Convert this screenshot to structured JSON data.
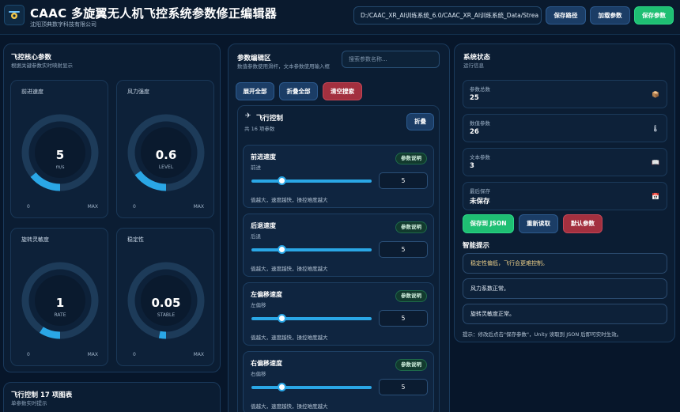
{
  "header": {
    "title": "CAAC 多旋翼无人机飞控系统参数修正编辑器",
    "company": "沈阳顶典数字科技有限公司",
    "path": "D:/CAAC_XR_AI训练系统_6.0/CAAC_XR_AI训练系统_Data/Strea",
    "save_path": "保存路径",
    "load_params": "加载参数",
    "save_params": "保存参数"
  },
  "core": {
    "title": "飞控核心参数",
    "subtitle": "根据关键参数实时映射显示",
    "gauges": [
      {
        "label": "前进速度",
        "value": "5",
        "unit": "m/s",
        "min": "0",
        "max": "MAX",
        "fraction": 0.14
      },
      {
        "label": "风力强度",
        "value": "0.6",
        "unit": "LEVEL",
        "min": "0",
        "max": "MAX",
        "fraction": 0.15
      },
      {
        "label": "旋转灵敏度",
        "value": "1",
        "unit": "RATE",
        "min": "0",
        "max": "MAX",
        "fraction": 0.09
      },
      {
        "label": "稳定性",
        "value": "0.05",
        "unit": "STABLE",
        "min": "0",
        "max": "MAX",
        "fraction": 0.03
      }
    ],
    "colors": {
      "arc": "#2aa7e6",
      "track": "#1d3b59"
    }
  },
  "chart_panel": {
    "title": "飞行控制 17 项图表",
    "subtitle": "单参数实时提示"
  },
  "editor": {
    "title": "参数编辑区",
    "subtitle": "数值参数使用滑杆，文本参数使用输入框",
    "search_placeholder": "搜索参数名称...",
    "expand_all": "展开全部",
    "collapse_all": "折叠全部",
    "clear_search": "清空搜索",
    "group": {
      "icon": "airplane-icon",
      "title": "飞行控制",
      "count": "共 16 项参数",
      "collapse": "折叠",
      "params": [
        {
          "name": "前进速度",
          "key": "前进",
          "badge": "参数说明",
          "value": "5",
          "fraction": 0.25,
          "hint": "值越大，速度越快，操控难度越大"
        },
        {
          "name": "后退速度",
          "key": "后退",
          "badge": "参数说明",
          "value": "5",
          "fraction": 0.25,
          "hint": "值越大，速度越快，操控难度越大"
        },
        {
          "name": "左偏移速度",
          "key": "左偏移",
          "badge": "参数说明",
          "value": "5",
          "fraction": 0.25,
          "hint": "值越大，速度越快，操控难度越大"
        },
        {
          "name": "右偏移速度",
          "key": "右偏移",
          "badge": "参数说明",
          "value": "5",
          "fraction": 0.25,
          "hint": "值越大，速度越快，操控难度越大"
        }
      ]
    }
  },
  "status": {
    "title": "系统状态",
    "subtitle": "运行信息",
    "cards": [
      {
        "label": "参数总数",
        "value": "25",
        "icon": "box-icon"
      },
      {
        "label": "数值参数",
        "value": "26",
        "icon": "thermometer-icon"
      },
      {
        "label": "文本参数",
        "value": "3",
        "icon": "document-icon"
      },
      {
        "label": "最后保存",
        "value": "未保存",
        "icon": "calendar-icon"
      }
    ],
    "save_json": "保存到 JSON",
    "reload": "重新读取",
    "defaults": "默认参数",
    "tips_title": "智能提示",
    "tips": [
      {
        "text": "稳定性偏低，飞行会更难控制。",
        "color": "#f0d28a"
      },
      {
        "text": "风力系数正常。",
        "color": "#e6eef8"
      },
      {
        "text": "旋转灵敏度正常。",
        "color": "#e6eef8"
      }
    ],
    "footer": "提示：修改后点击\"保存参数\"，Unity 读取到 JSON 后即可实时生效。"
  }
}
